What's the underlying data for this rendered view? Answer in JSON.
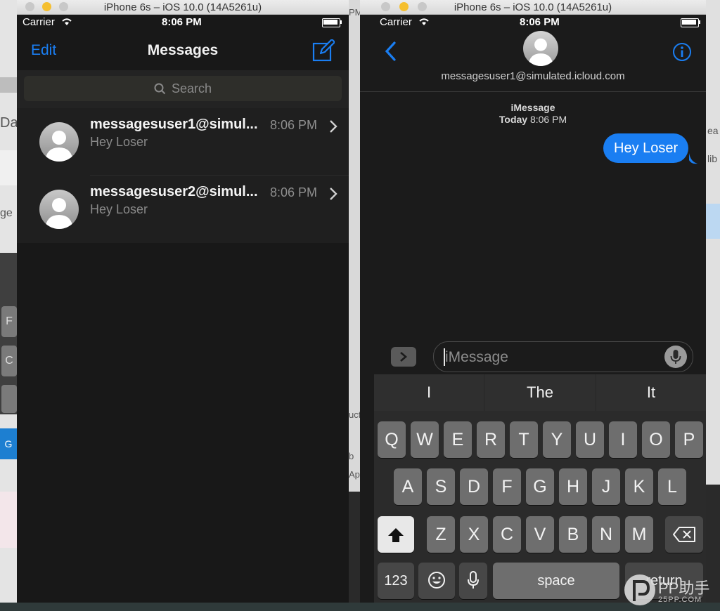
{
  "simulators": [
    {
      "window_title": "iPhone 6s – iOS 10.0 (14A5261u)",
      "status": {
        "carrier": "Carrier",
        "time": "8:06 PM"
      },
      "nav": {
        "edit_label": "Edit",
        "title": "Messages",
        "compose_icon": "compose-icon"
      },
      "search": {
        "placeholder": "Search"
      },
      "conversations": [
        {
          "name": "messagesuser1@simul...",
          "time": "8:06 PM",
          "preview": "Hey Loser"
        },
        {
          "name": "messagesuser2@simul...",
          "time": "8:06 PM",
          "preview": "Hey Loser"
        }
      ]
    },
    {
      "window_title": "iPhone 6s – iOS 10.0 (14A5261u)",
      "status": {
        "carrier": "Carrier",
        "time": "8:06 PM"
      },
      "contact": {
        "email": "messagesuser1@simulated.icloud.com"
      },
      "thread": {
        "service": "iMessage",
        "day": "Today",
        "time": "8:06 PM"
      },
      "messages": [
        {
          "text": "Hey Loser",
          "direction": "outgoing"
        }
      ],
      "composer": {
        "placeholder": "iMessage"
      },
      "keyboard": {
        "suggestions": [
          "I",
          "The",
          "It"
        ],
        "row1": [
          "Q",
          "W",
          "E",
          "R",
          "T",
          "Y",
          "U",
          "I",
          "O",
          "P"
        ],
        "row2": [
          "A",
          "S",
          "D",
          "F",
          "G",
          "H",
          "J",
          "K",
          "L"
        ],
        "row3": [
          "Z",
          "X",
          "C",
          "V",
          "B",
          "N",
          "M"
        ],
        "numbers_key": "123",
        "space_key": "space",
        "return_key": "return"
      }
    }
  ],
  "backdrop": {
    "fragments": [
      "Da",
      "ge",
      "F",
      "C",
      "G",
      "PM",
      "ea",
      "lib",
      "ucts",
      "b",
      "Ap",
      "Fo"
    ]
  },
  "watermark": {
    "brand": "PP助手",
    "site": "25PP.COM"
  },
  "colors": {
    "ios_blue": "#1a7ef2",
    "bg_dark": "#1b1b1b"
  }
}
